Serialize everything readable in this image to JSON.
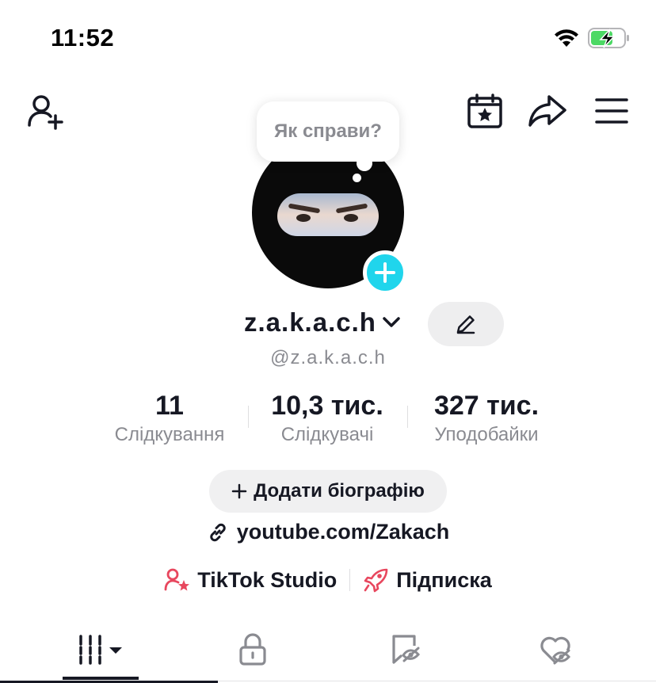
{
  "status_bar": {
    "time": "11:52",
    "icons": [
      "wifi-icon",
      "battery-charging-icon"
    ],
    "battery_color": "#4cd964"
  },
  "header": {
    "left_icon": "add-friend-icon",
    "right_icons": [
      "calendar-star-icon",
      "share-icon",
      "hamburger-menu-icon"
    ]
  },
  "profile": {
    "note_bubble": "Як справи?",
    "avatar_add_badge_icon": "plus-icon",
    "badge_color": "#20d5ec",
    "username": "z.a.k.a.c.h",
    "handle": "@z.a.k.a.c.h",
    "edit_icon": "pencil-icon"
  },
  "stats": [
    {
      "value": "11",
      "label": "Слідкування"
    },
    {
      "value": "10,3 тис.",
      "label": "Слідкувачі"
    },
    {
      "value": "327 тис.",
      "label": "Уподобайки"
    }
  ],
  "bio_button": {
    "icon": "plus-icon",
    "label": "Додати біографію"
  },
  "link": {
    "icon": "link-icon",
    "text": "youtube.com/Zakach"
  },
  "shortcuts": [
    {
      "icon": "person-star-icon",
      "label": "TikTok Studio",
      "color": "#e8475e"
    },
    {
      "icon": "rocket-icon",
      "label": "Підписка",
      "color": "#e8475e"
    }
  ],
  "tabs": [
    {
      "icon": "grid-icon",
      "active": true
    },
    {
      "icon": "lock-icon",
      "active": false
    },
    {
      "icon": "repost-icon",
      "active": false
    },
    {
      "icon": "liked-heart-icon",
      "active": false
    }
  ]
}
